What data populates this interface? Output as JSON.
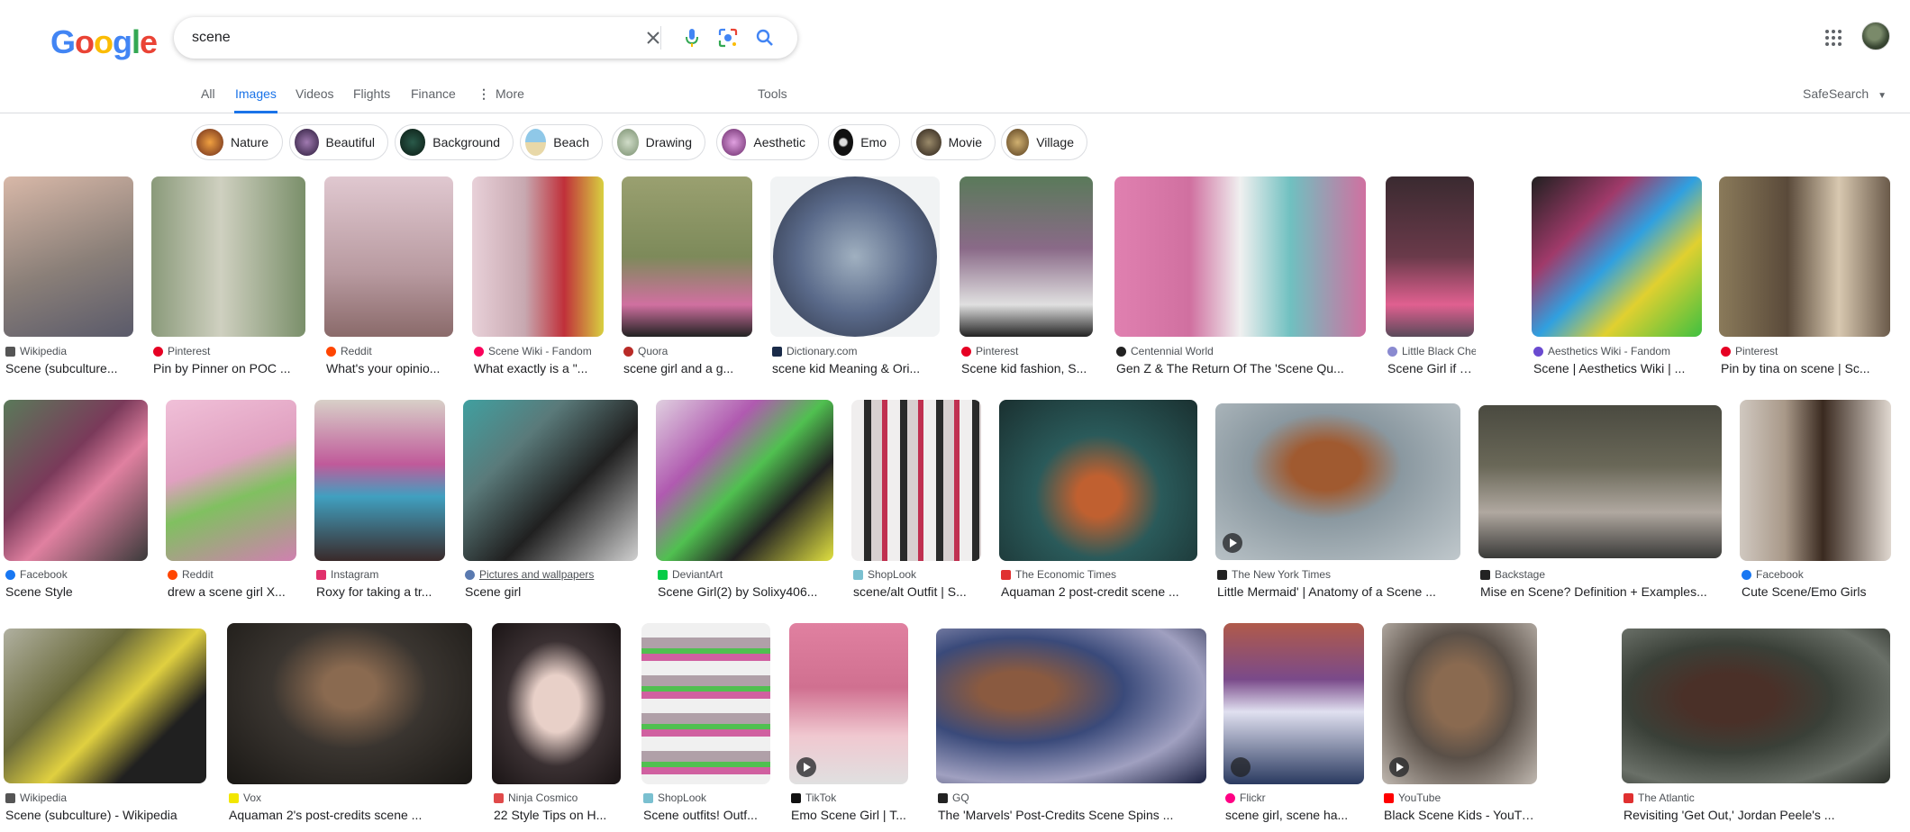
{
  "search": {
    "query": "scene"
  },
  "logo": {
    "letters": [
      "G",
      "o",
      "o",
      "g",
      "l",
      "e"
    ],
    "colors": [
      "#4285F4",
      "#EA4335",
      "#FBBC05",
      "#4285F4",
      "#34A853",
      "#EA4335"
    ]
  },
  "tabs": [
    {
      "label": "All"
    },
    {
      "label": "Images"
    },
    {
      "label": "Videos"
    },
    {
      "label": "Flights"
    },
    {
      "label": "Finance"
    },
    {
      "label": "More"
    }
  ],
  "tools_label": "Tools",
  "safesearch_label": "SafeSearch",
  "chips": [
    {
      "label": "Nature",
      "color": "#c86a2b"
    },
    {
      "label": "Beautiful",
      "color": "#6a4a7a"
    },
    {
      "label": "Background",
      "color": "#1f3a2e"
    },
    {
      "label": "Beach",
      "color": "#8fb6cc"
    },
    {
      "label": "Drawing",
      "color": "#a8b8a0"
    },
    {
      "label": "Aesthetic",
      "color": "#a05aa0"
    },
    {
      "label": "Emo",
      "color": "#222222"
    },
    {
      "label": "Movie",
      "color": "#5a4a3a"
    },
    {
      "label": "Village",
      "color": "#9a7a4a"
    }
  ],
  "results": [
    {
      "source": "Wikipedia",
      "title": "Scene (subculture...",
      "color": "#8a7f78",
      "icon_color": "#555555"
    },
    {
      "source": "Pinterest",
      "title": "Pin by Pinner on POC ...",
      "color": "#7a8f6a",
      "icon_color": "#E60023"
    },
    {
      "source": "Reddit",
      "title": "What's your opinio...",
      "color": "#b89aa0",
      "icon_color": "#FF4500"
    },
    {
      "source": "Scene Wiki - Fandom",
      "title": "What exactly is a \"...",
      "color": "#c7a8b0",
      "icon_color": "#FA005A"
    },
    {
      "source": "Quora",
      "title": "scene girl and a g...",
      "color": "#7d8a5a",
      "icon_color": "#B92B27"
    },
    {
      "source": "Dictionary.com",
      "title": "scene kid Meaning & Ori...",
      "color": "#5a6a8a",
      "icon_color": "#1A2B49"
    },
    {
      "source": "Pinterest",
      "title": "Scene kid fashion, S...",
      "color": "#8a6a88",
      "icon_color": "#E60023"
    },
    {
      "source": "Centennial World",
      "title": "Gen Z & The Return Of The 'Scene Qu...",
      "color": "#d070a0",
      "icon_color": "#222222"
    },
    {
      "source": "Little Black Cherry",
      "title": "Scene Girl if You'r...",
      "color": "#6a3a4a",
      "icon_color": "#8a8ad0"
    },
    {
      "source": "Aesthetics Wiki - Fandom",
      "title": "Scene | Aesthetics Wiki | ...",
      "color": "#a03a6a",
      "icon_color": "#6a4ad0"
    },
    {
      "source": "Pinterest",
      "title": "Pin by tina on scene | Sc...",
      "color": "#5a4a3a",
      "icon_color": "#E60023"
    },
    {
      "source": "Facebook",
      "title": "Scene Style",
      "color": "#7a3a5a",
      "icon_color": "#1877F2"
    },
    {
      "source": "Reddit",
      "title": "drew a scene girl X...",
      "color": "#e0a0c0",
      "icon_color": "#FF4500"
    },
    {
      "source": "Instagram",
      "title": "Roxy for taking a tr...",
      "color": "#c05a9a",
      "icon_color": "#E1306C"
    },
    {
      "source": "Pictures and wallpapers",
      "title": "Scene girl",
      "color": "#5a7a7a",
      "icon_color": "#5a7ab0"
    },
    {
      "source": "DeviantArt",
      "title": "Scene Girl(2) by Solixy406...",
      "color": "#b05ab0",
      "icon_color": "#05CC47"
    },
    {
      "source": "ShopLook",
      "title": "scene/alt Outfit | S...",
      "color": "#d8d0d0",
      "icon_color": "#7ac0d0"
    },
    {
      "source": "The Economic Times",
      "title": "Aquaman 2 post-credit scene ...",
      "color": "#2a5a5a",
      "icon_color": "#E03030"
    },
    {
      "source": "The New York Times",
      "title": "Little Mermaid' | Anatomy of a Scene ...",
      "color": "#8a98a0",
      "icon_color": "#222222"
    },
    {
      "source": "Backstage",
      "title": "Mise en Scene? Definition + Examples...",
      "color": "#6a6858",
      "icon_color": "#222222"
    },
    {
      "source": "Facebook",
      "title": "Cute Scene/Emo Girls",
      "color": "#a89888",
      "icon_color": "#1877F2"
    },
    {
      "source": "Wikipedia",
      "title": "Scene (subculture) - Wikipedia",
      "color": "#6a6a3a",
      "icon_color": "#555555"
    },
    {
      "source": "Vox",
      "title": "Aquaman 2's post-credits scene ...",
      "color": "#3a3530",
      "icon_color": "#F2E600"
    },
    {
      "source": "Ninja Cosmico",
      "title": "22 Style Tips on H...",
      "color": "#3a3032",
      "icon_color": "#E04a4a"
    },
    {
      "source": "ShopLook",
      "title": "Scene outfits! Outf...",
      "color": "#b0a0a8",
      "icon_color": "#7ac0d0"
    },
    {
      "source": "TikTok",
      "title": "Emo Scene Girl | T...",
      "color": "#d07090",
      "icon_color": "#111111"
    },
    {
      "source": "GQ",
      "title": "The 'Marvels' Post-Credits Scene Spins ...",
      "color": "#3a4a7a",
      "icon_color": "#222222"
    },
    {
      "source": "Flickr",
      "title": "scene girl, scene ha...",
      "color": "#7a4a8a",
      "icon_color": "#FF0084"
    },
    {
      "source": "YouTube",
      "title": "Black Scene Kids - YouTube",
      "color": "#5a5048",
      "icon_color": "#FF0000"
    },
    {
      "source": "The Atlantic",
      "title": "Revisiting 'Get Out,' Jordan Peele's ...",
      "color": "#3a4038",
      "icon_color": "#E03030"
    }
  ]
}
